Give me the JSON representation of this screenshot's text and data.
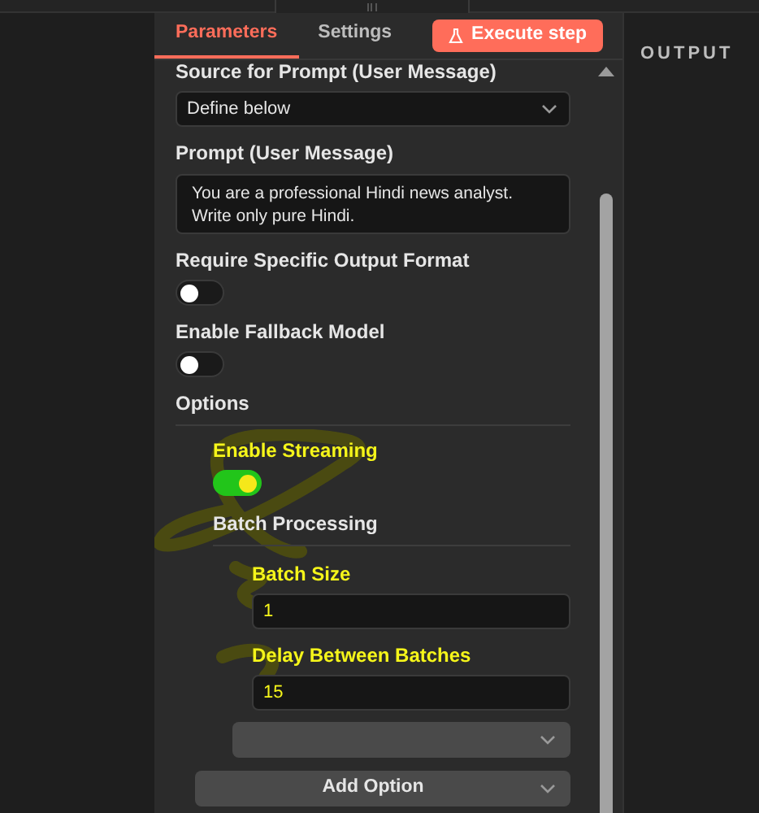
{
  "tabs": [
    {
      "label": "Parameters",
      "selected": true
    },
    {
      "label": "Settings",
      "selected": false
    }
  ],
  "execute_button": {
    "label": "Execute step"
  },
  "fields": [
    {
      "kind": "select",
      "label": "Source for Prompt (User Message)",
      "value": "Define below"
    },
    {
      "kind": "textarea",
      "label": "Prompt (User Message)",
      "value": "You are a professional Hindi news analyst. Write only pure Hindi."
    },
    {
      "kind": "toggle",
      "label": "Require Specific Output Format",
      "on": false
    },
    {
      "kind": "toggle",
      "label": "Enable Fallback Model",
      "on": false
    }
  ],
  "options": {
    "title": "Options",
    "items": [
      {
        "kind": "toggle",
        "label": "Enable Streaming",
        "on": true,
        "highlighted": true
      },
      {
        "kind": "group",
        "label": "Batch Processing",
        "highlighted": false,
        "children": [
          {
            "kind": "input",
            "label": "Batch Size",
            "value": "1",
            "highlighted": true
          },
          {
            "kind": "input",
            "label": "Delay Between Batches",
            "value": "15",
            "highlighted": true
          }
        ]
      }
    ],
    "add_option_button": {
      "label": "Add Option"
    }
  },
  "output_panel": {
    "title": "OUTPUT"
  }
}
